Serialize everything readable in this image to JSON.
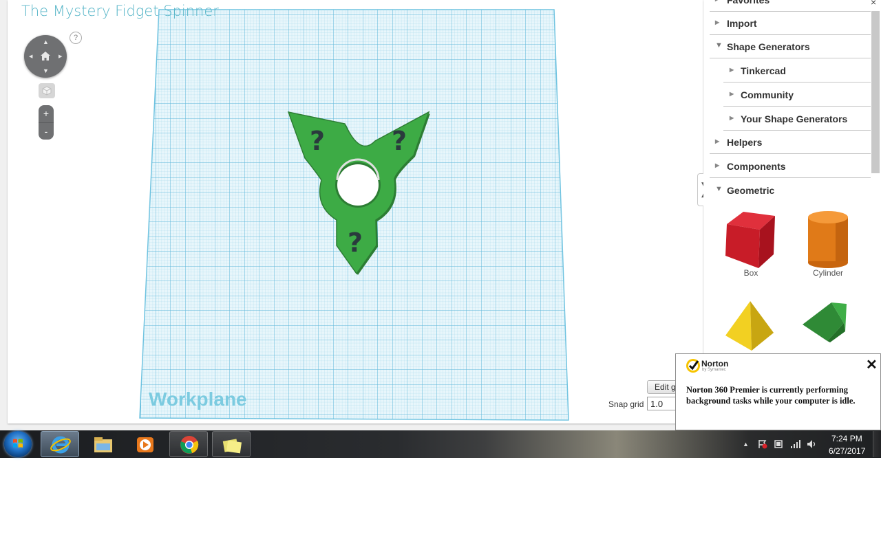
{
  "design": {
    "title": "The Mystery Fidget Spinner",
    "workplane_label": "Workplane",
    "help_symbol": "?",
    "zoom_in": "+",
    "zoom_out": "-",
    "edit_grid_label": "Edit grid",
    "snap_grid_label": "Snap grid",
    "snap_grid_value": "1.0"
  },
  "panel": {
    "items": [
      {
        "label": "Favorites",
        "expanded": false,
        "level": 0
      },
      {
        "label": "Import",
        "expanded": false,
        "level": 0
      },
      {
        "label": "Shape Generators",
        "expanded": true,
        "level": 0
      },
      {
        "label": "Tinkercad",
        "expanded": false,
        "level": 1
      },
      {
        "label": "Community",
        "expanded": false,
        "level": 1
      },
      {
        "label": "Your Shape Generators",
        "expanded": false,
        "level": 1
      },
      {
        "label": "Helpers",
        "expanded": false,
        "level": 0
      },
      {
        "label": "Components",
        "expanded": false,
        "level": 0
      },
      {
        "label": "Geometric",
        "expanded": true,
        "level": 0
      }
    ],
    "shapes": [
      {
        "label": "Box",
        "color": "#d42030"
      },
      {
        "label": "Cylinder",
        "color": "#e87a1c"
      },
      {
        "label": "",
        "color": "#f0d020"
      },
      {
        "label": "",
        "color": "#3aa040"
      }
    ],
    "close_symbol": "×",
    "collapse_symbol": "❭"
  },
  "norton": {
    "brand": "Norton",
    "brand_sub": "by Symantec",
    "message": "Norton 360 Premier is currently performing background tasks while your computer is idle.",
    "close_symbol": "✕"
  },
  "taskbar": {
    "time": "7:24 PM",
    "date": "6/27/2017"
  },
  "colors": {
    "title": "#58b6c8",
    "workplane_grid": "#6fc3e0",
    "spinner": "#3dab45",
    "spinner_dark": "#2d7d34",
    "mark": "#2a3a3d"
  }
}
